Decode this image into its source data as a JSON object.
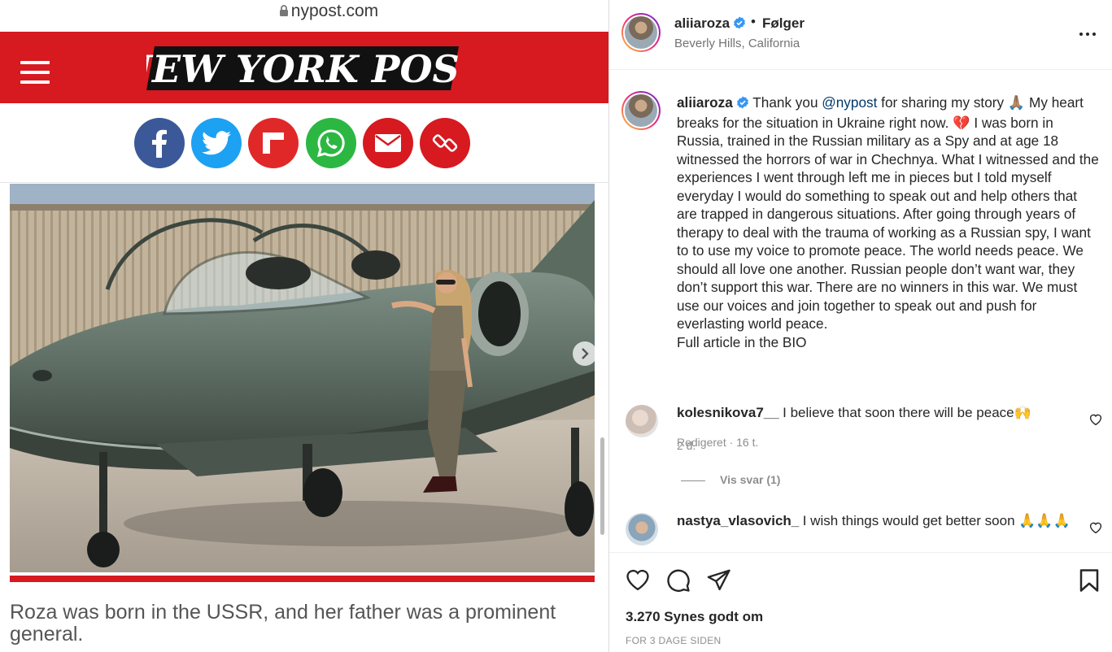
{
  "browser": {
    "url": "nypost.com"
  },
  "article": {
    "brand": "NEW YORK POST",
    "photo_caption": "Roza was born in the USSR, and her father was a prominent general."
  },
  "share_buttons": [
    {
      "name": "facebook",
      "color": "#3b5998",
      "icon": "facebook-icon"
    },
    {
      "name": "twitter",
      "color": "#1da1f2",
      "icon": "twitter-icon"
    },
    {
      "name": "flipboard",
      "color": "#e12828",
      "icon": "flipboard-icon"
    },
    {
      "name": "whatsapp",
      "color": "#2cb742",
      "icon": "whatsapp-icon"
    },
    {
      "name": "email",
      "color": "#d71920",
      "icon": "envelope-icon"
    },
    {
      "name": "copy-link",
      "color": "#d71920",
      "icon": "link-icon"
    }
  ],
  "instagram": {
    "header": {
      "username": "aliiaroza",
      "separator": "•",
      "follow_label": "Følger",
      "location": "Beverly Hills, California"
    },
    "caption": {
      "username": "aliiaroza",
      "before_mention": "Thank you ",
      "mention": "@nypost",
      "body": " for sharing my story 🙏🏽 My heart breaks for the situation in Ukraine right now. 💔 I was born in Russia, trained in the Russian military as a Spy and at age 18 witnessed the horrors of war in Chechnya. What I witnessed and the experiences I went through left me in pieces but I told myself everyday I would do something to speak out and help others that are trapped in dangerous situations. After going through years of therapy to deal with the trauma of working as a Russian spy, I want to to use my voice to promote peace. The world needs peace. We should all love one another. Russian people don’t want war, they don’t support this war. There are no winners in this war. We must use our voices and join together to speak out and push for everlasting world peace.",
      "footer_line": "Full article in the BIO",
      "meta": "Redigeret · 16 t."
    },
    "comments": [
      {
        "username": "kolesnikova7__",
        "text": "I believe that soon there will be peace🙌",
        "time": "2 d.",
        "replies_label": "Vis svar (1)"
      },
      {
        "username": "nastya_vlasovich_",
        "text": "I wish things would get better soon 🙏🙏🙏"
      }
    ],
    "likes": "3.270 Synes godt om",
    "post_age": "FOR 3 DAGE SIDEN"
  }
}
